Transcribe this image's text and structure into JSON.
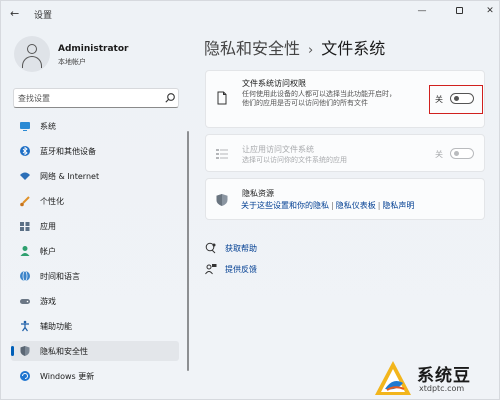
{
  "window": {
    "title": "设置"
  },
  "user": {
    "name": "Administrator",
    "type": "本地帐户"
  },
  "search": {
    "placeholder": "查找设置"
  },
  "nav": {
    "items": [
      {
        "label": "系统",
        "icon": "monitor-icon"
      },
      {
        "label": "蓝牙和其他设备",
        "icon": "bluetooth-icon"
      },
      {
        "label": "网络 & Internet",
        "icon": "wifi-icon"
      },
      {
        "label": "个性化",
        "icon": "brush-icon"
      },
      {
        "label": "应用",
        "icon": "apps-icon"
      },
      {
        "label": "帐户",
        "icon": "account-icon"
      },
      {
        "label": "时间和语言",
        "icon": "globe-clock-icon"
      },
      {
        "label": "游戏",
        "icon": "gamepad-icon"
      },
      {
        "label": "辅助功能",
        "icon": "accessibility-icon"
      },
      {
        "label": "隐私和安全性",
        "icon": "shield-icon",
        "active": true
      },
      {
        "label": "Windows 更新",
        "icon": "update-icon"
      }
    ]
  },
  "breadcrumb": {
    "parent": "隐私和安全性",
    "separator": "›",
    "current": "文件系统"
  },
  "cards": {
    "file_access": {
      "title": "文件系统访问权限",
      "description": "任何使用此设备的人都可以选择当此功能开启时，他们的应用是否可以访问他们的所有文件",
      "toggle_label": "关",
      "toggle_on": false
    },
    "app_access": {
      "title": "让应用访问文件系统",
      "description": "选择可以访问你的文件系统的应用",
      "toggle_label": "关",
      "toggle_on": false,
      "disabled": true
    },
    "privacy_resources": {
      "title": "隐私资源",
      "links": [
        "关于这些设置和你的隐私",
        "隐私仪表板",
        "隐私声明"
      ],
      "divider": "|"
    }
  },
  "help": {
    "get_help": "获取帮助",
    "feedback": "提供反馈"
  },
  "watermark": {
    "title": "系统豆",
    "url": "xtdptc.com"
  },
  "colors": {
    "accent": "#005fb8",
    "highlight_box": "#d0201e",
    "link": "#003e92"
  }
}
